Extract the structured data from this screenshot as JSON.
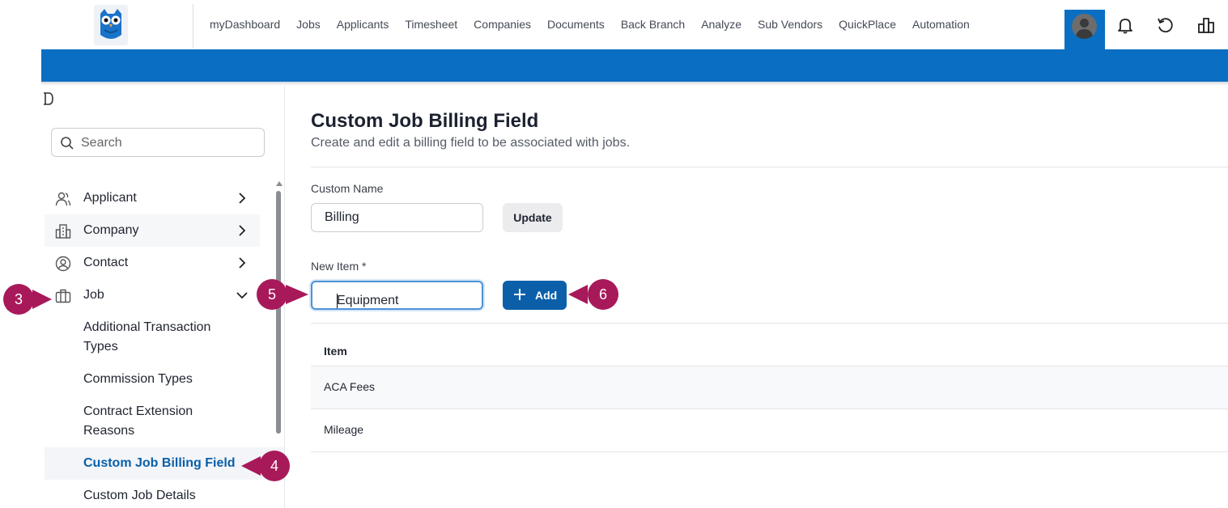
{
  "topnav": {
    "items": [
      "myDashboard",
      "Jobs",
      "Applicants",
      "Timesheet",
      "Companies",
      "Documents",
      "Back Branch",
      "Analyze",
      "Sub Vendors",
      "QuickPlace",
      "Automation"
    ]
  },
  "sidebar": {
    "search_placeholder": "Search",
    "menu": [
      {
        "label": "Applicant",
        "icon": "users-icon"
      },
      {
        "label": "Company",
        "icon": "building-icon"
      },
      {
        "label": "Contact",
        "icon": "user-circle-icon"
      },
      {
        "label": "Job",
        "icon": "briefcase-icon"
      }
    ],
    "job_subitems": [
      "Additional Transaction Types",
      "Commission Types",
      "Contract Extension Reasons",
      "Custom Job Billing Field",
      "Custom Job Details"
    ]
  },
  "main": {
    "title": "Custom Job Billing Field",
    "subtitle": "Create and edit a billing field to be associated with jobs.",
    "custom_name_label": "Custom Name",
    "custom_name_value": "Billing",
    "update_label": "Update",
    "new_item_label": "New Item *",
    "new_item_value": "Equipment",
    "add_label": "Add",
    "table": {
      "header": "Item",
      "rows": [
        "ACA Fees",
        "Mileage"
      ]
    }
  },
  "callouts": [
    "3",
    "4",
    "5",
    "6"
  ],
  "colors": {
    "brand_blue": "#0a6fc2",
    "button_blue": "#0a5fa8",
    "callout": "#a8195a",
    "active_text": "#0a5fa8"
  }
}
